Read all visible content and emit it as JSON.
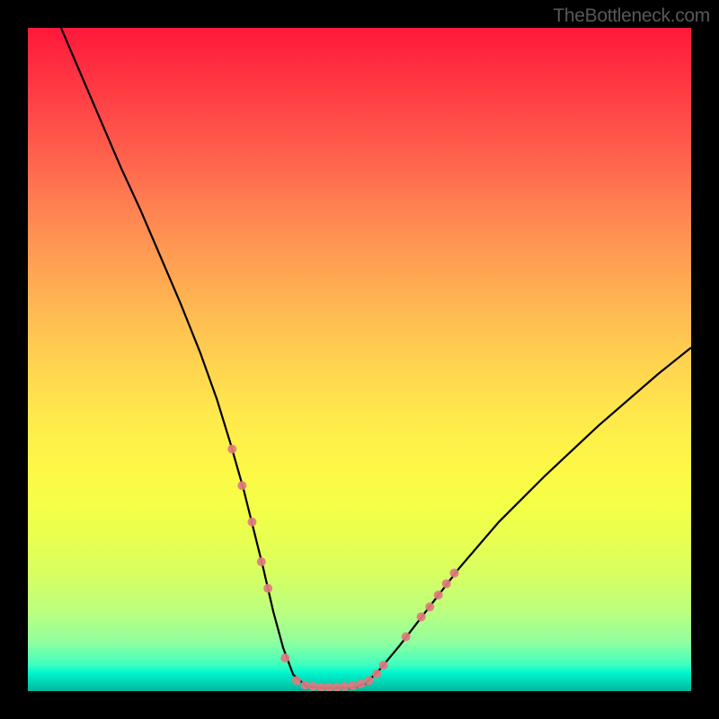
{
  "watermark": "TheBottleneck.com",
  "chart_data": {
    "type": "line",
    "title": "",
    "xlabel": "",
    "ylabel": "",
    "xlim": [
      0,
      100
    ],
    "ylim": [
      0,
      100
    ],
    "grid": false,
    "legend": false,
    "series": [
      {
        "name": "bottleneck-curve",
        "x": [
          5,
          8,
          11,
          14,
          17,
          20,
          23,
          26,
          28.5,
          30.5,
          32.5,
          34,
          35.5,
          37,
          38.5,
          40,
          42,
          44,
          45,
          47,
          49,
          51,
          53,
          56,
          60,
          65,
          71,
          78,
          86,
          95,
          100
        ],
        "y": [
          100,
          93,
          86,
          79,
          72.5,
          65.5,
          58.5,
          51,
          44,
          37.5,
          30.5,
          24.5,
          18.5,
          12,
          6.5,
          2.5,
          0.7,
          0.5,
          0.5,
          0.5,
          0.5,
          1.2,
          3.2,
          6.8,
          12,
          18.5,
          25.5,
          32.5,
          40,
          47.8,
          51.8
        ]
      }
    ],
    "scatter_points": {
      "name": "marker-dots",
      "points": [
        {
          "x": 30.8,
          "y": 36.5,
          "r": 5
        },
        {
          "x": 32.3,
          "y": 31.0,
          "r": 5
        },
        {
          "x": 33.8,
          "y": 25.5,
          "r": 5
        },
        {
          "x": 35.2,
          "y": 19.5,
          "r": 5
        },
        {
          "x": 36.2,
          "y": 15.5,
          "r": 5
        },
        {
          "x": 38.8,
          "y": 5.0,
          "r": 5
        },
        {
          "x": 40.5,
          "y": 1.6,
          "r": 5
        },
        {
          "x": 41.8,
          "y": 0.9,
          "r": 5
        },
        {
          "x": 43.0,
          "y": 0.7,
          "r": 5
        },
        {
          "x": 44.2,
          "y": 0.6,
          "r": 5
        },
        {
          "x": 45.4,
          "y": 0.6,
          "r": 5
        },
        {
          "x": 46.6,
          "y": 0.6,
          "r": 5
        },
        {
          "x": 47.8,
          "y": 0.7,
          "r": 5
        },
        {
          "x": 49.0,
          "y": 0.8,
          "r": 5
        },
        {
          "x": 50.2,
          "y": 1.1,
          "r": 5
        },
        {
          "x": 51.4,
          "y": 1.6,
          "r": 5
        },
        {
          "x": 52.6,
          "y": 2.6,
          "r": 5
        },
        {
          "x": 53.6,
          "y": 3.9,
          "r": 5
        },
        {
          "x": 57.0,
          "y": 8.2,
          "r": 5
        },
        {
          "x": 59.3,
          "y": 11.2,
          "r": 5
        },
        {
          "x": 60.6,
          "y": 12.7,
          "r": 5
        },
        {
          "x": 61.9,
          "y": 14.5,
          "r": 5
        },
        {
          "x": 63.1,
          "y": 16.2,
          "r": 5
        },
        {
          "x": 64.3,
          "y": 17.8,
          "r": 5
        }
      ]
    }
  }
}
